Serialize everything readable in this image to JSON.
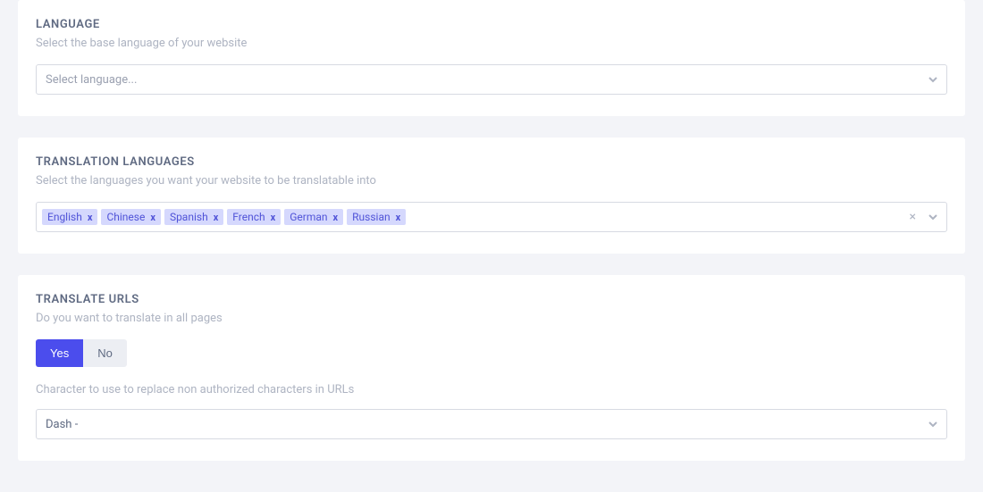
{
  "language": {
    "title": "LANGUAGE",
    "desc": "Select the base language of your website",
    "placeholder": "Select language..."
  },
  "translation_languages": {
    "title": "TRANSLATION LANGUAGES",
    "desc": "Select the languages you want your website to be translatable into",
    "tags": [
      "English",
      "Chinese",
      "Spanish",
      "French",
      "German",
      "Russian"
    ]
  },
  "translate_urls": {
    "title": "TRANSLATE URLS",
    "desc": "Do you want to translate in all pages",
    "yes": "Yes",
    "no": "No",
    "char_desc": "Character to use to replace non authorized characters in URLs",
    "char_value": "Dash -"
  }
}
